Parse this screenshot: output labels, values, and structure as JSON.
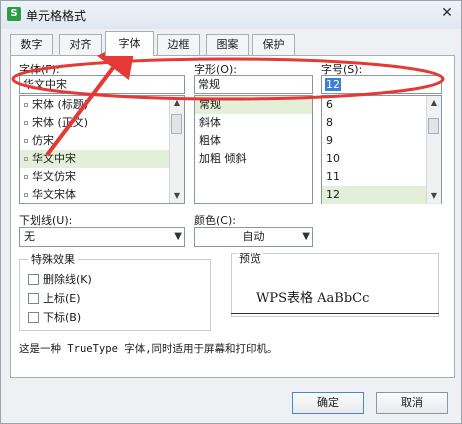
{
  "window": {
    "title": "单元格格式",
    "app_icon": "S"
  },
  "tabs": [
    {
      "label": "数字",
      "active": false
    },
    {
      "label": "对齐",
      "active": false
    },
    {
      "label": "字体",
      "active": true
    },
    {
      "label": "边框",
      "active": false
    },
    {
      "label": "图案",
      "active": false
    },
    {
      "label": "保护",
      "active": false
    }
  ],
  "font": {
    "label": "字体(F):",
    "value": "华文中宋",
    "list": [
      "宋体 (标题)",
      "宋体 (正文)",
      "仿宋",
      "华文中宋",
      "华文仿宋",
      "华文宋体"
    ],
    "selected": "华文中宋"
  },
  "style": {
    "label": "字形(O):",
    "value": "常规",
    "list": [
      "常规",
      "斜体",
      "粗体",
      "加粗 倾斜"
    ],
    "selected": "常规"
  },
  "size": {
    "label": "字号(S):",
    "value": "12",
    "list": [
      "6",
      "8",
      "9",
      "10",
      "11",
      "12"
    ],
    "selected": "12"
  },
  "underline": {
    "label": "下划线(U):",
    "value": "无"
  },
  "color": {
    "label": "颜色(C):",
    "value": "自动"
  },
  "effects": {
    "legend": "特殊效果",
    "items": [
      "删除线(K)",
      "上标(E)",
      "下标(B)"
    ]
  },
  "preview": {
    "legend": "预览",
    "sample": "WPS表格 AaBbCc"
  },
  "info": "这是一种 TrueType 字体,同时适用于屏幕和打印机。",
  "buttons": {
    "ok": "确定",
    "cancel": "取消"
  },
  "colors": {
    "annotation_red": "#e53935",
    "selection_green": "#e3efd8",
    "ok_border": "#4c87c8"
  }
}
